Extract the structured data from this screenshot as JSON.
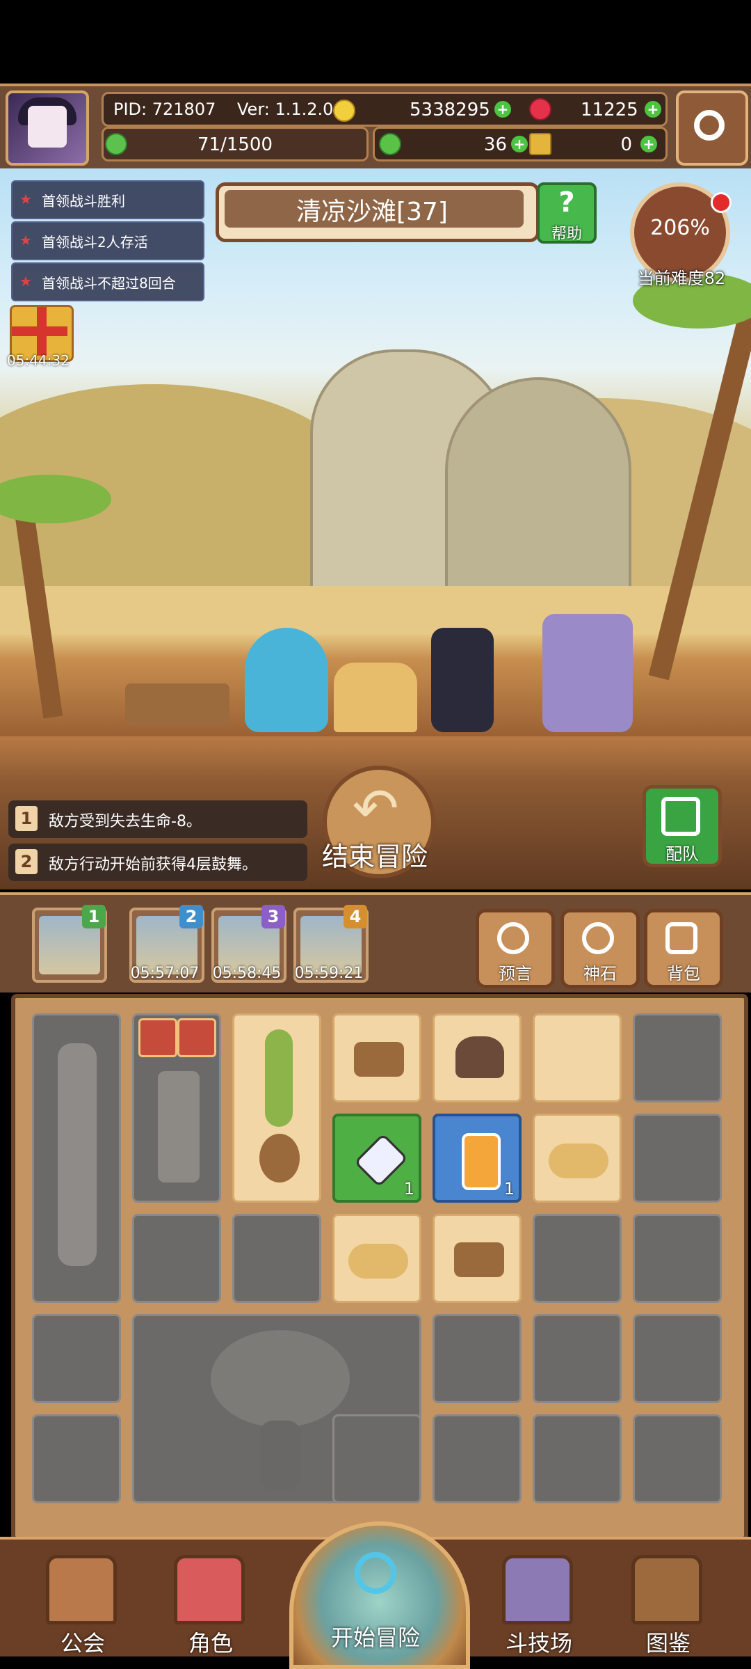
{
  "header": {
    "pid": "PID: 721807",
    "version": "Ver: 1.1.2.0",
    "gold": "5338295",
    "gems": "11225",
    "energy": "71/1500",
    "clover": "36",
    "keys": "0"
  },
  "quests": [
    "首领战斗胜利",
    "首领战斗2人存活",
    "首领战斗不超过8回合"
  ],
  "gift_timer": "05:44:32",
  "stage": {
    "name": "清凉沙滩[37]",
    "help_label": "帮助"
  },
  "difficulty": {
    "percent": "206%",
    "label": "当前难度82"
  },
  "effects": [
    {
      "num": "1",
      "text": "敌方受到失去生命-8。"
    },
    {
      "num": "2",
      "text": "敌方行动开始前获得4层鼓舞。"
    }
  ],
  "end_button_label": "结束冒险",
  "team_label": "配队",
  "cards": [
    {
      "badge": "1",
      "timer": "",
      "color": "#4ea64a"
    },
    {
      "badge": "2",
      "timer": "05:57:07",
      "color": "#3f8fcd"
    },
    {
      "badge": "3",
      "timer": "05:58:45",
      "color": "#8b5fc7"
    },
    {
      "badge": "4",
      "timer": "05:59:21",
      "color": "#d68f2e"
    }
  ],
  "tools": [
    "预言",
    "神石",
    "背包"
  ],
  "inventory": {
    "crystal_qty": "1",
    "potion_qty": "1"
  },
  "nav": [
    "公会",
    "角色",
    "开始冒险",
    "斗技场",
    "图鉴"
  ]
}
